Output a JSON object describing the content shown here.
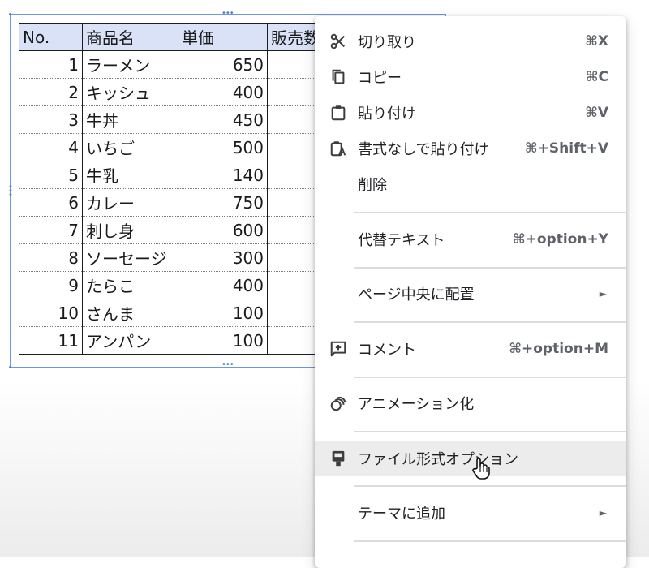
{
  "table": {
    "headers": {
      "no": "No.",
      "name": "商品名",
      "price": "単価",
      "qty": "販売数"
    },
    "rows": [
      {
        "no": "1",
        "name": "ラーメン",
        "price": "650"
      },
      {
        "no": "2",
        "name": "キッシュ",
        "price": "400"
      },
      {
        "no": "3",
        "name": "牛丼",
        "price": "450"
      },
      {
        "no": "4",
        "name": "いちご",
        "price": "500"
      },
      {
        "no": "5",
        "name": "牛乳",
        "price": "140"
      },
      {
        "no": "6",
        "name": "カレー",
        "price": "750"
      },
      {
        "no": "7",
        "name": "刺し身",
        "price": "600"
      },
      {
        "no": "8",
        "name": "ソーセージ",
        "price": "300"
      },
      {
        "no": "9",
        "name": "たらこ",
        "price": "400"
      },
      {
        "no": "10",
        "name": "さんま",
        "price": "100"
      },
      {
        "no": "11",
        "name": "アンパン",
        "price": "100"
      }
    ]
  },
  "menu": {
    "cut": {
      "label": "切り取り",
      "shortcut": "⌘X",
      "icon": "scissors-icon"
    },
    "copy": {
      "label": "コピー",
      "shortcut": "⌘C",
      "icon": "copy-icon"
    },
    "paste": {
      "label": "貼り付け",
      "shortcut": "⌘V",
      "icon": "clipboard-icon"
    },
    "paste_plain": {
      "label": "書式なしで貼り付け",
      "shortcut": "⌘+Shift+V",
      "icon": "clipboard-plain-icon"
    },
    "delete": {
      "label": "削除"
    },
    "alt_text": {
      "label": "代替テキスト",
      "shortcut": "⌘+option+Y"
    },
    "center_page": {
      "label": "ページ中央に配置",
      "submenu_arrow": "►"
    },
    "comment": {
      "label": "コメント",
      "shortcut": "⌘+option+M",
      "icon": "add-comment-icon"
    },
    "animate": {
      "label": "アニメーション化",
      "icon": "animation-icon"
    },
    "format_options": {
      "label": "ファイル形式オプション",
      "icon": "format-options-icon",
      "highlighted": true
    },
    "add_to_theme": {
      "label": "テーマに追加",
      "submenu_arrow": "►"
    }
  },
  "colors": {
    "header_fill": "#d9e2f7",
    "selection_blue": "#6f96e0",
    "hover_bg": "#ececec"
  }
}
